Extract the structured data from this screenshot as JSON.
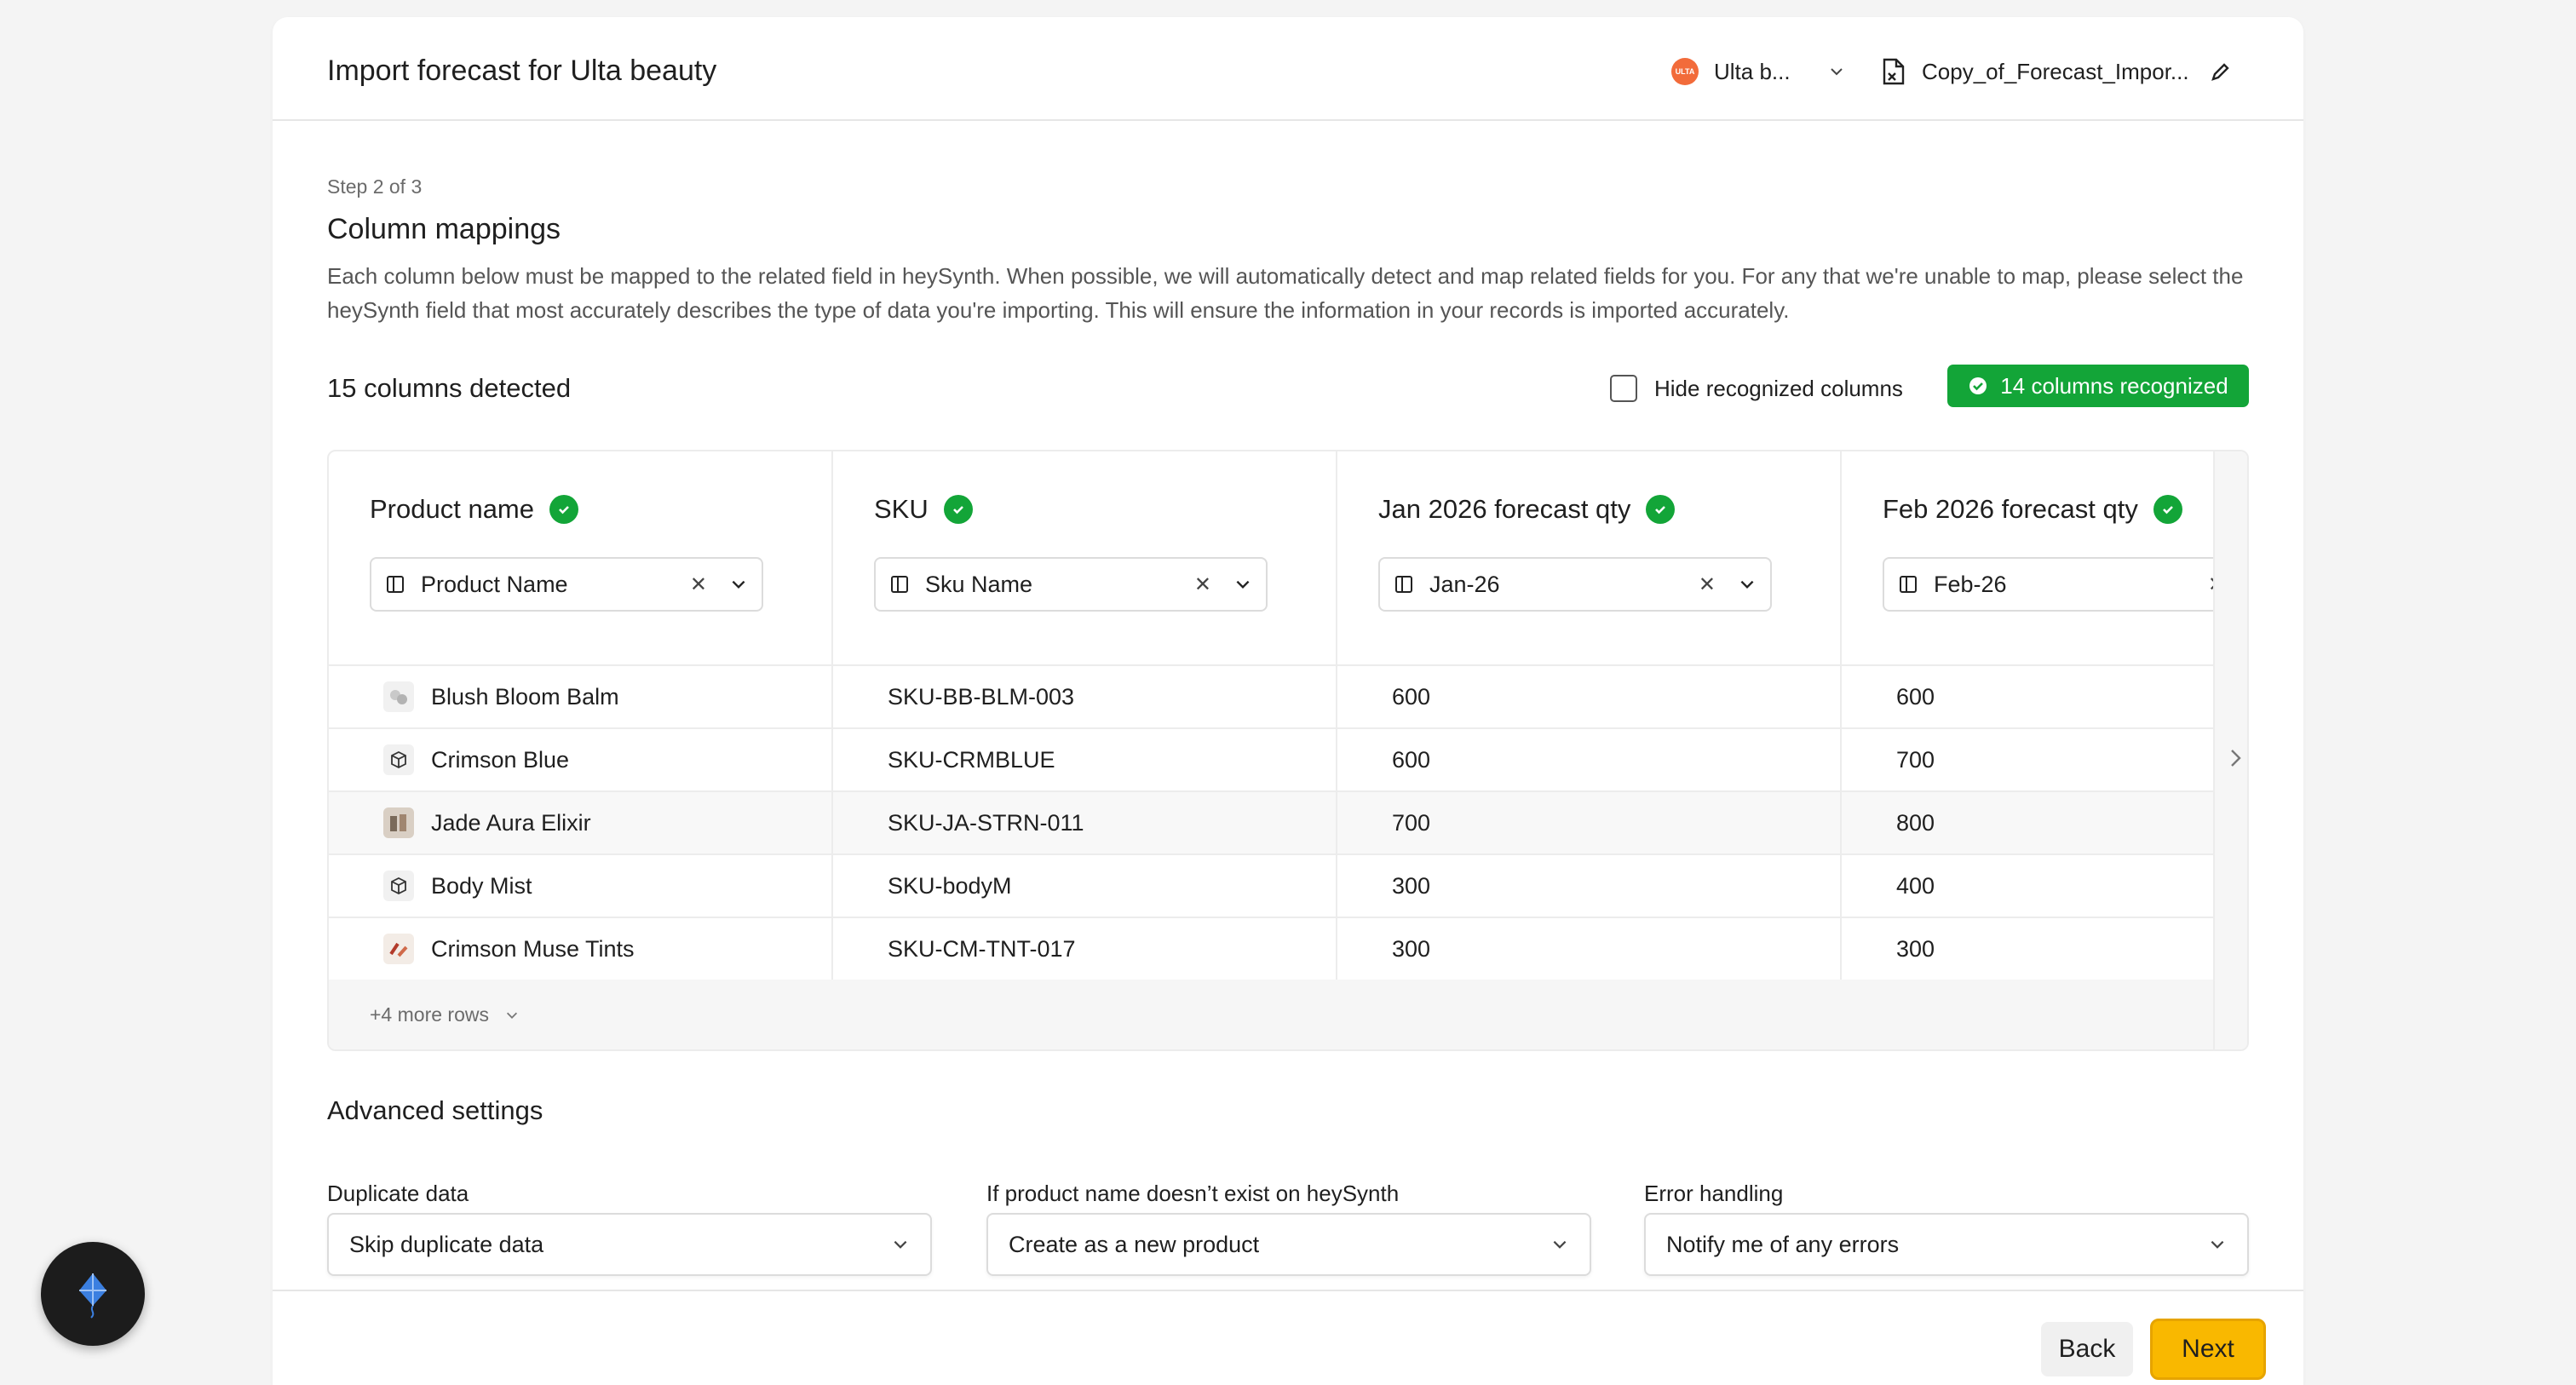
{
  "header": {
    "title": "Import forecast for Ulta beauty",
    "company": {
      "name": "Ulta b...",
      "logo_text": "ULTA",
      "logo_color": "#f26b3a"
    },
    "file_name": "Copy_of_Forecast_Impor..."
  },
  "step": {
    "label": "Step 2 of 3",
    "title": "Column mappings",
    "description": "Each column below must be mapped to the related field in heySynth. When possible, we will automatically detect and map related fields for you. For any that we're unable to map, please select the heySynth field that most accurately describes the type of data you're importing. This will ensure the information in your records is imported accurately."
  },
  "summary": {
    "columns_detected": "15 columns detected",
    "hide_recognized_label": "Hide recognized columns",
    "recognized_badge": "14 columns recognized",
    "badge_color": "#13a538"
  },
  "table": {
    "columns": [
      {
        "title": "Product name",
        "mapped_to": "Product Name"
      },
      {
        "title": "SKU",
        "mapped_to": "Sku Name"
      },
      {
        "title": "Jan 2026 forecast qty",
        "mapped_to": "Jan-26"
      },
      {
        "title": "Feb 2026 forecast qty",
        "mapped_to": "Feb-26"
      }
    ],
    "rows": [
      {
        "product": "Blush Bloom Balm",
        "sku": "SKU-BB-BLM-003",
        "jan": "600",
        "feb": "600"
      },
      {
        "product": "Crimson Blue",
        "sku": "SKU-CRMBLUE",
        "jan": "600",
        "feb": "700"
      },
      {
        "product": "Jade Aura Elixir",
        "sku": "SKU-JA-STRN-011",
        "jan": "700",
        "feb": "800"
      },
      {
        "product": "Body Mist",
        "sku": "SKU-bodyM",
        "jan": "300",
        "feb": "400"
      },
      {
        "product": "Crimson Muse Tints",
        "sku": "SKU-CM-TNT-017",
        "jan": "300",
        "feb": "300"
      }
    ],
    "more_rows": "+4 more rows"
  },
  "advanced": {
    "title": "Advanced settings",
    "duplicate": {
      "label": "Duplicate data",
      "value": "Skip duplicate data"
    },
    "missing_product": {
      "label": "If product name doesn’t exist on heySynth",
      "value": "Create as a new product"
    },
    "errors": {
      "label": "Error handling",
      "value": "Notify me of any errors"
    }
  },
  "footer": {
    "back_label": "Back",
    "next_label": "Next",
    "accent": "#f9b800"
  }
}
